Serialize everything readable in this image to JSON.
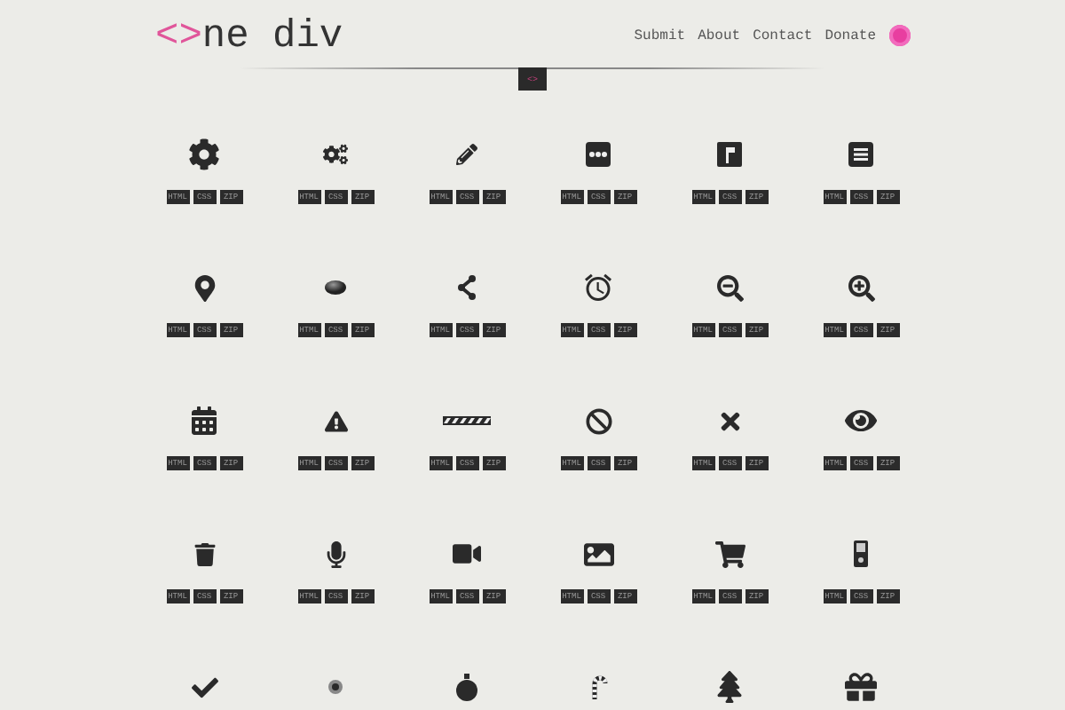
{
  "header": {
    "logo_mark": "<>",
    "logo_text": "ne div",
    "nav": [
      "Submit",
      "About",
      "Contact",
      "Donate"
    ]
  },
  "divider_badge": "<>",
  "icons": [
    {
      "kind": "gear",
      "buttons": [
        "HTML",
        "CSS",
        "ZIP"
      ]
    },
    {
      "kind": "gears",
      "buttons": [
        "HTML",
        "CSS",
        "ZIP"
      ]
    },
    {
      "kind": "pencil",
      "buttons": [
        "HTML",
        "CSS",
        "ZIP"
      ]
    },
    {
      "kind": "dots",
      "buttons": [
        "HTML",
        "CSS",
        "ZIP"
      ]
    },
    {
      "kind": "flag",
      "buttons": [
        "HTML",
        "CSS",
        "ZIP"
      ]
    },
    {
      "kind": "list",
      "buttons": [
        "HTML",
        "CSS",
        "ZIP"
      ]
    },
    {
      "kind": "pin",
      "buttons": [
        "HTML",
        "CSS",
        "ZIP"
      ]
    },
    {
      "kind": "ellipse",
      "buttons": [
        "HTML",
        "CSS",
        "ZIP"
      ]
    },
    {
      "kind": "share",
      "buttons": [
        "HTML",
        "CSS",
        "ZIP"
      ]
    },
    {
      "kind": "alarm",
      "buttons": [
        "HTML",
        "CSS",
        "ZIP"
      ]
    },
    {
      "kind": "zoomout",
      "buttons": [
        "HTML",
        "CSS",
        "ZIP"
      ]
    },
    {
      "kind": "zoomin",
      "buttons": [
        "HTML",
        "CSS",
        "ZIP"
      ]
    },
    {
      "kind": "calendar",
      "buttons": [
        "HTML",
        "CSS",
        "ZIP"
      ]
    },
    {
      "kind": "warning",
      "buttons": [
        "HTML",
        "CSS",
        "ZIP"
      ]
    },
    {
      "kind": "progress",
      "buttons": [
        "HTML",
        "CSS",
        "ZIP"
      ]
    },
    {
      "kind": "ban",
      "buttons": [
        "HTML",
        "CSS",
        "ZIP"
      ]
    },
    {
      "kind": "close",
      "buttons": [
        "HTML",
        "CSS",
        "ZIP"
      ]
    },
    {
      "kind": "eye",
      "buttons": [
        "HTML",
        "CSS",
        "ZIP"
      ]
    },
    {
      "kind": "trash",
      "buttons": [
        "HTML",
        "CSS",
        "ZIP"
      ]
    },
    {
      "kind": "mic",
      "buttons": [
        "HTML",
        "CSS",
        "ZIP"
      ]
    },
    {
      "kind": "video",
      "buttons": [
        "HTML",
        "CSS",
        "ZIP"
      ]
    },
    {
      "kind": "image",
      "buttons": [
        "HTML",
        "CSS",
        "ZIP"
      ]
    },
    {
      "kind": "cart",
      "buttons": [
        "HTML",
        "CSS",
        "ZIP"
      ]
    },
    {
      "kind": "player",
      "buttons": [
        "HTML",
        "CSS",
        "ZIP"
      ]
    },
    {
      "kind": "check"
    },
    {
      "kind": "target"
    },
    {
      "kind": "ornament"
    },
    {
      "kind": "cane"
    },
    {
      "kind": "tree"
    },
    {
      "kind": "gift"
    }
  ]
}
